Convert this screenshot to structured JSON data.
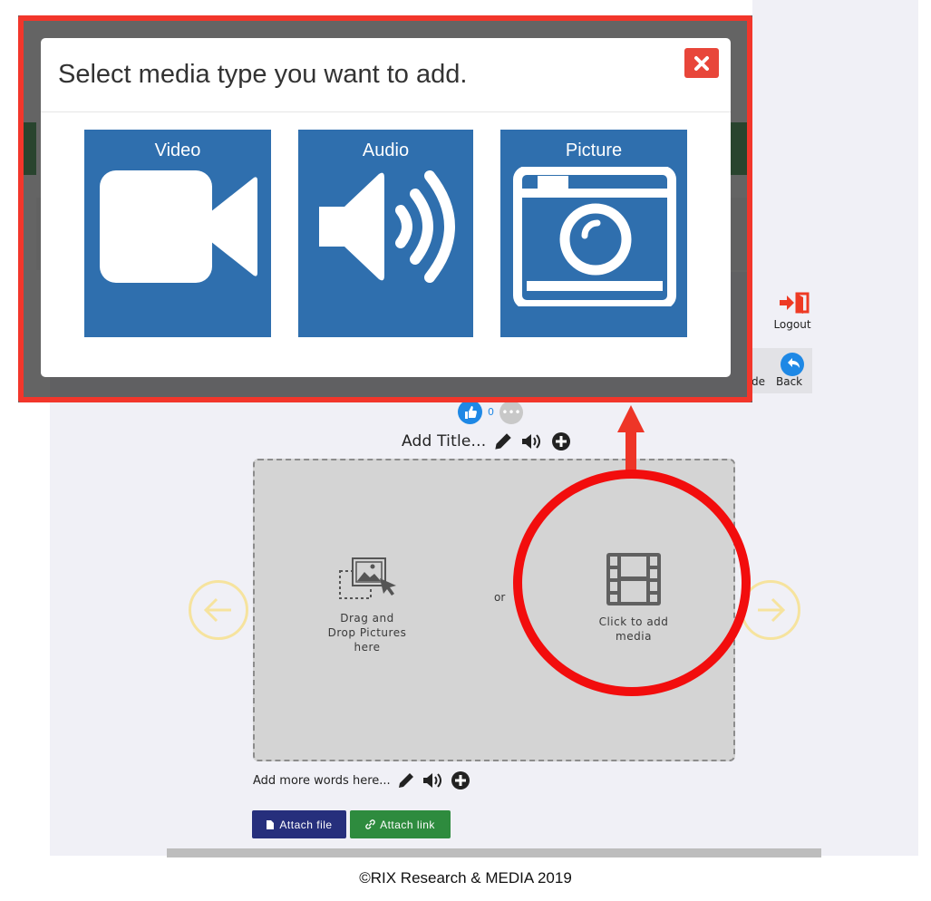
{
  "modal": {
    "title": "Select media type you want to add.",
    "close_icon": "close-icon",
    "options": [
      {
        "label": "Video",
        "icon": "video-camera-icon"
      },
      {
        "label": "Audio",
        "icon": "speaker-icon"
      },
      {
        "label": "Picture",
        "icon": "camera-icon"
      }
    ]
  },
  "header": {
    "logout_label": "Logout",
    "back_label": "Back",
    "partial_label": "de"
  },
  "likes": {
    "count": "0"
  },
  "page": {
    "title_placeholder": "Add Title...",
    "drag_text": "Drag and\nDrop Pictures\nhere",
    "or_text": "or",
    "media_text": "Click to add\nmedia",
    "words_placeholder": "Add more words here..."
  },
  "actions": {
    "attach_file": "Attach file",
    "attach_link": "Attach link"
  },
  "colors": {
    "modal_tile": "#2f6fae",
    "highlight_red": "#f2362b",
    "attach_file_bg": "#262f7c",
    "attach_link_bg": "#2e8b3e"
  },
  "footer": {
    "text": "©RIX  Research & MEDIA 2019"
  }
}
